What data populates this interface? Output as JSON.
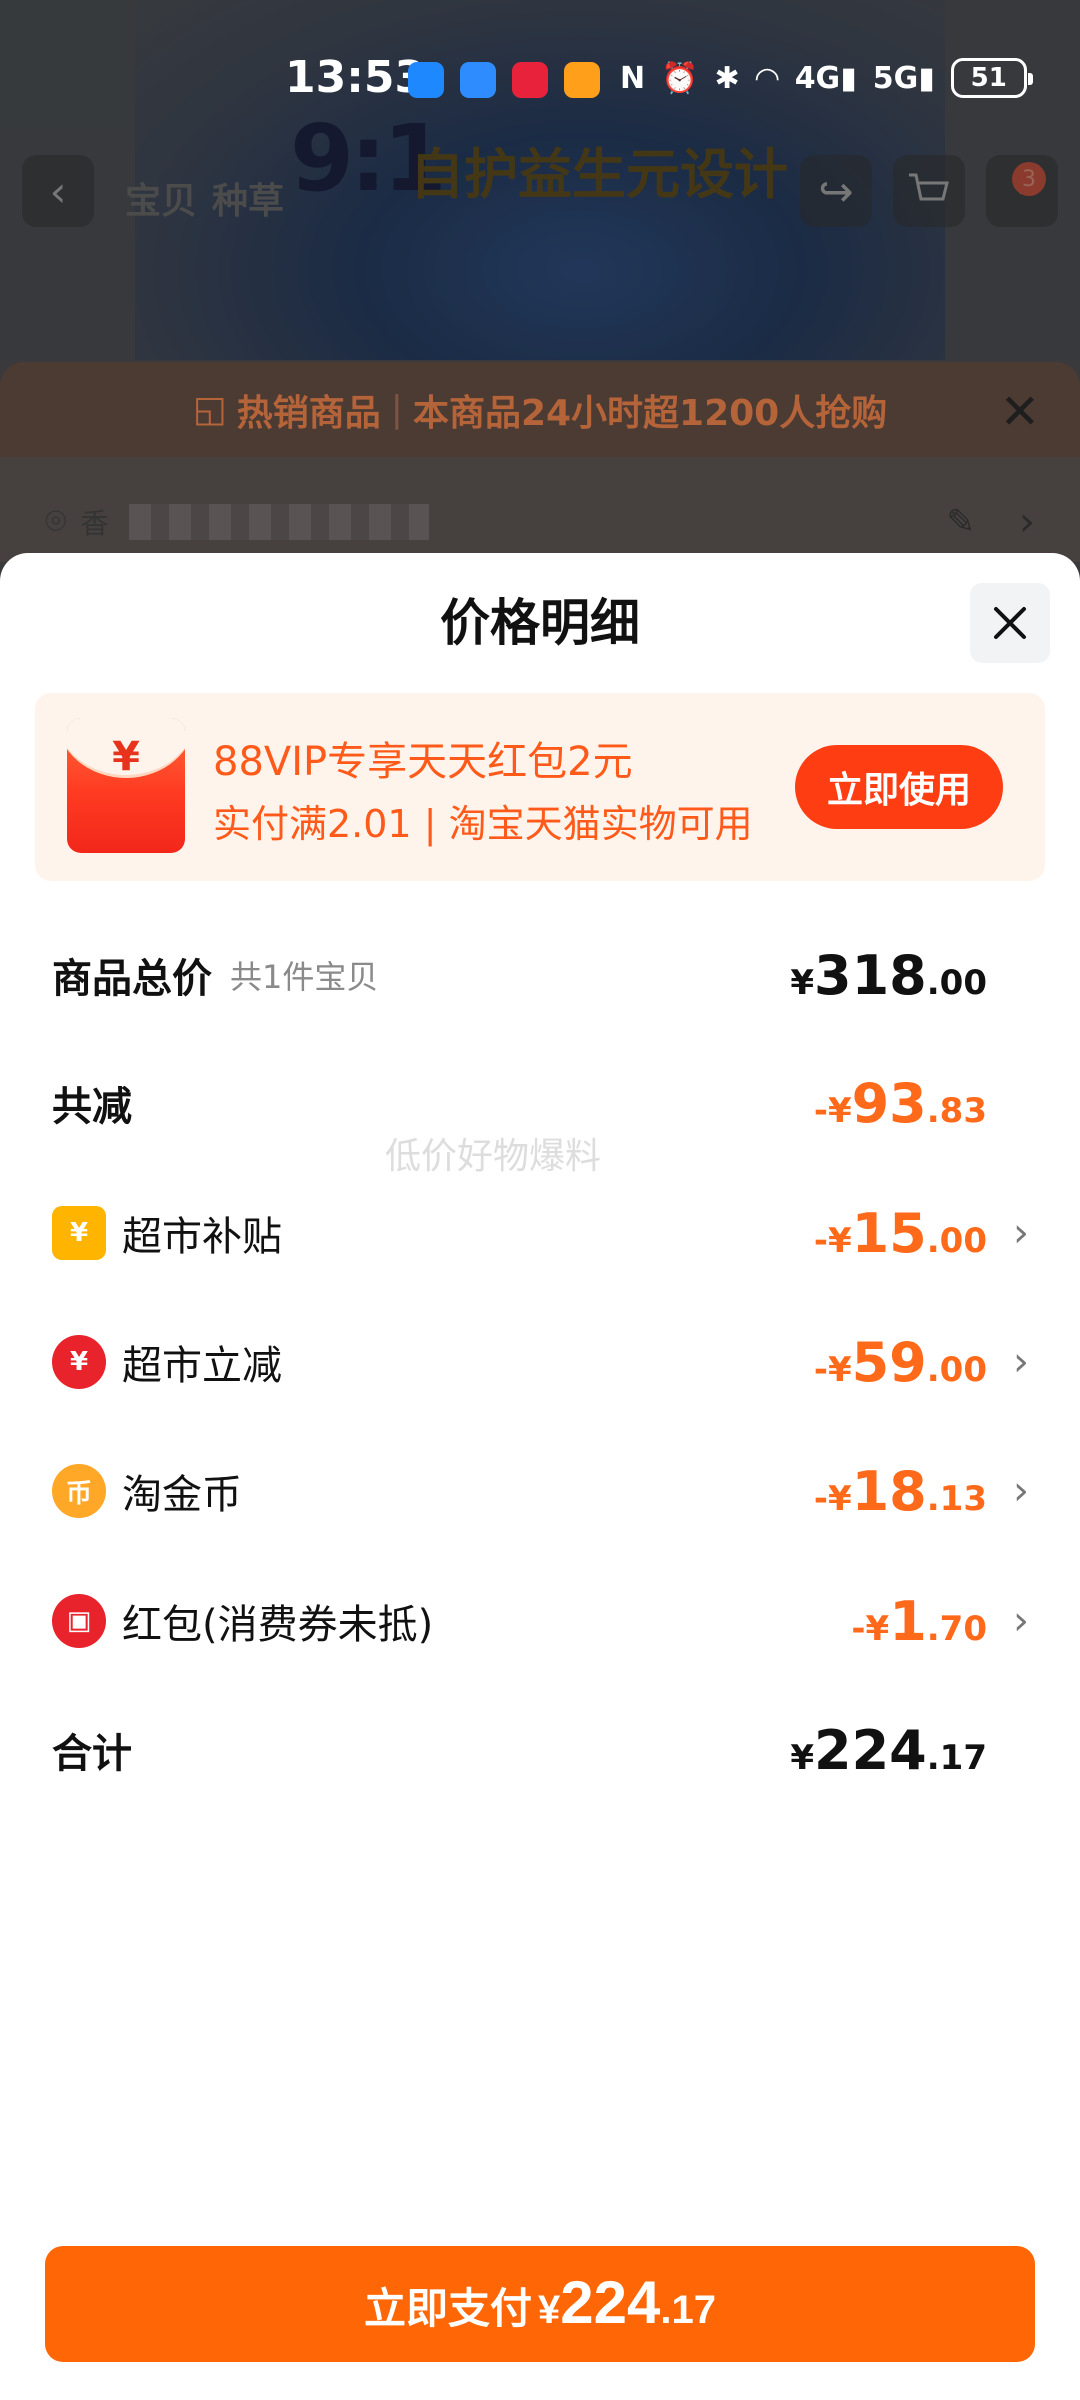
{
  "status_bar": {
    "time": "13:53",
    "network_4g": "4G",
    "network_5g": "5G",
    "battery": "51"
  },
  "background": {
    "hero_big_text": "9:1",
    "hero_slogan": "自护益生元设计",
    "tabs": [
      "宝贝",
      "种草"
    ],
    "cart_badge": "3",
    "hot_banner": {
      "tag": "热销商品",
      "separator": "|",
      "text": "本商品24小时超1200人抢购"
    },
    "address_prefix": "香"
  },
  "sheet": {
    "title": "价格明细",
    "promo": {
      "envelope_symbol": "¥",
      "line1": "88VIP专享天天红包2元",
      "line2": "实付满2.01 | 淘宝天猫实物可用",
      "button": "立即使用"
    },
    "rows": {
      "total": {
        "label": "商品总价",
        "sub": "共1件宝贝",
        "sign": "¥",
        "int": "318",
        "dec": ".00"
      },
      "discount": {
        "label": "共减",
        "sign": "-¥",
        "int": "93",
        "dec": ".83"
      },
      "items": [
        {
          "label": "超市补贴",
          "icon": "supermarket-subsidy-icon",
          "sign": "-¥",
          "int": "15",
          "dec": ".00"
        },
        {
          "label": "超市立减",
          "icon": "instant-discount-icon",
          "sign": "-¥",
          "int": "59",
          "dec": ".00"
        },
        {
          "label": "淘金币",
          "icon": "gold-coin-icon",
          "sign": "-¥",
          "int": "18",
          "dec": ".13"
        },
        {
          "label": "红包(消费券未抵)",
          "icon": "red-packet-icon",
          "sign": "-¥",
          "int": "1",
          "dec": ".70"
        }
      ],
      "sum": {
        "label": "合计",
        "sign": "¥",
        "int": "224",
        "dec": ".17"
      }
    },
    "pay_button": {
      "text": "立即支付",
      "sign": "¥",
      "int": "224",
      "dec": ".17"
    },
    "watermark": "低价好物爆料"
  },
  "colors": {
    "accent_orange": "#ff6605",
    "discount_orange": "#ff6a1a",
    "promo_red": "#ff3d12"
  }
}
